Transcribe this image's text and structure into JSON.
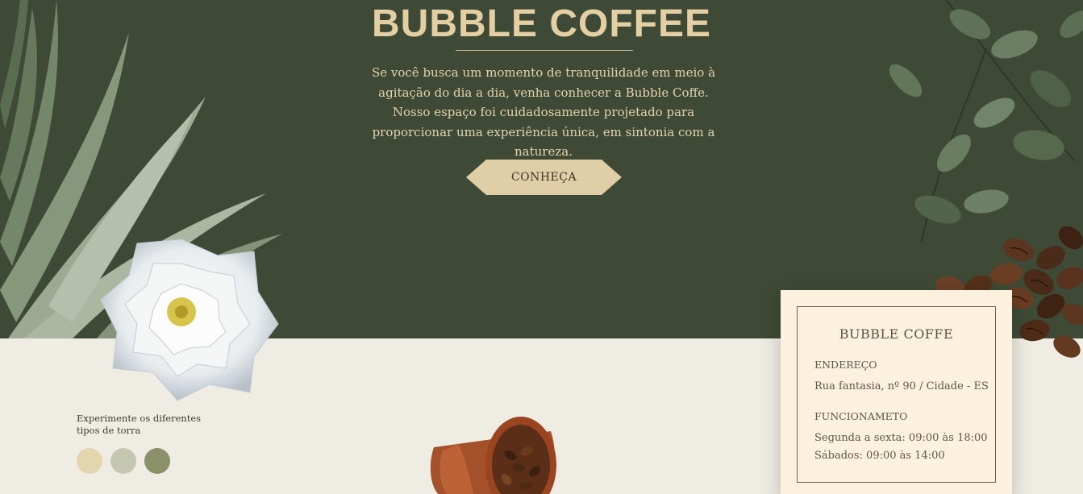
{
  "hero": {
    "title": "BUBBLE COFFEE",
    "intro": "Se você busca um momento de tranquilidade em meio à agitação do dia a dia, venha conhecer a Bubble Coffe. Nosso espaço foi cuidadosamente projetado para proporcionar uma experiência única, em sintonia com a natureza.",
    "cta_label": "CONHEÇA"
  },
  "info": {
    "name": "BUBBLE COFFE",
    "address_label": "ENDEREÇO",
    "address": "Rua fantasia, nº 90 / Cidade - ES",
    "hours_label": "FUNCIONAMETO",
    "hours_weekday": "Segunda a sexta: 09:00 às 18:00",
    "hours_saturday": "Sábados: 09:00 às 14:00"
  },
  "roast": {
    "caption": "Experimente os diferentes tipos de torra",
    "swatches": [
      "#e3d5ad",
      "#c6c7b1",
      "#8a9168"
    ]
  },
  "colors": {
    "hero_bg": "#3e4a35",
    "lower_bg": "#efede3",
    "accent": "#e0cfa6",
    "card_bg": "#fbf1de"
  },
  "decor": {
    "left": [
      "leaves-illustration",
      "white-rose-illustration"
    ],
    "right": [
      "eucalyptus-illustration",
      "coffee-beans-illustration"
    ],
    "center": [
      "coffee-cup-illustration"
    ]
  }
}
